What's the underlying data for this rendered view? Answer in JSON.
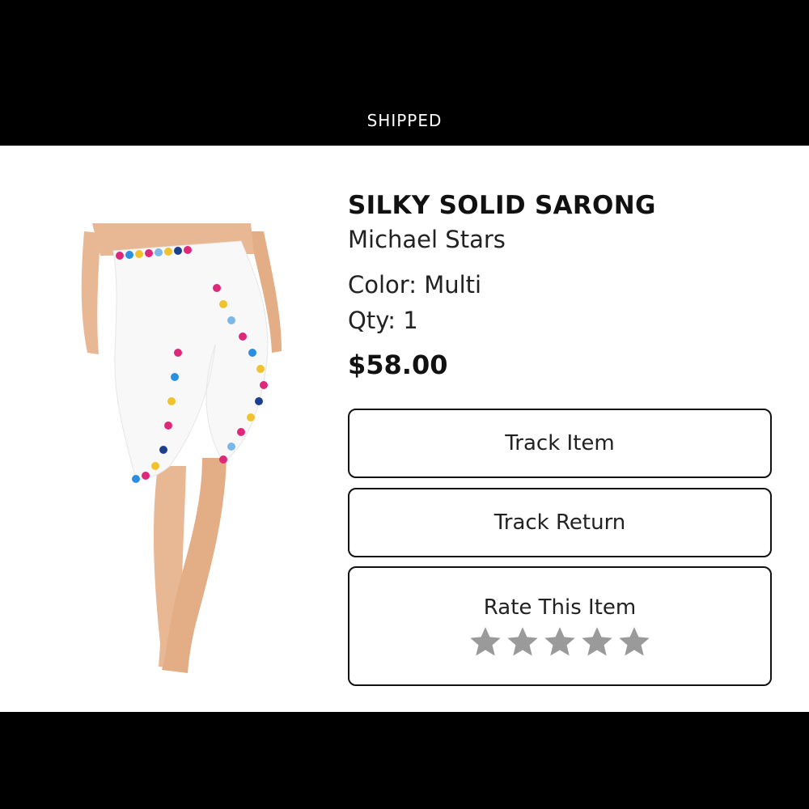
{
  "header": {
    "status": "SHIPPED"
  },
  "product": {
    "name": "SILKY SOLID SARONG",
    "brand": "Michael Stars",
    "color": "Color: Multi",
    "qty": "Qty: 1",
    "price": "$58.00"
  },
  "actions": {
    "track_item": "Track Item",
    "track_return": "Track Return",
    "rate_label": "Rate This Item"
  },
  "rating": {
    "max": 5,
    "value": 0,
    "star_color": "#9a9a9a"
  },
  "colors": {
    "bar": "#000000",
    "text": "#111111",
    "border": "#111111"
  }
}
